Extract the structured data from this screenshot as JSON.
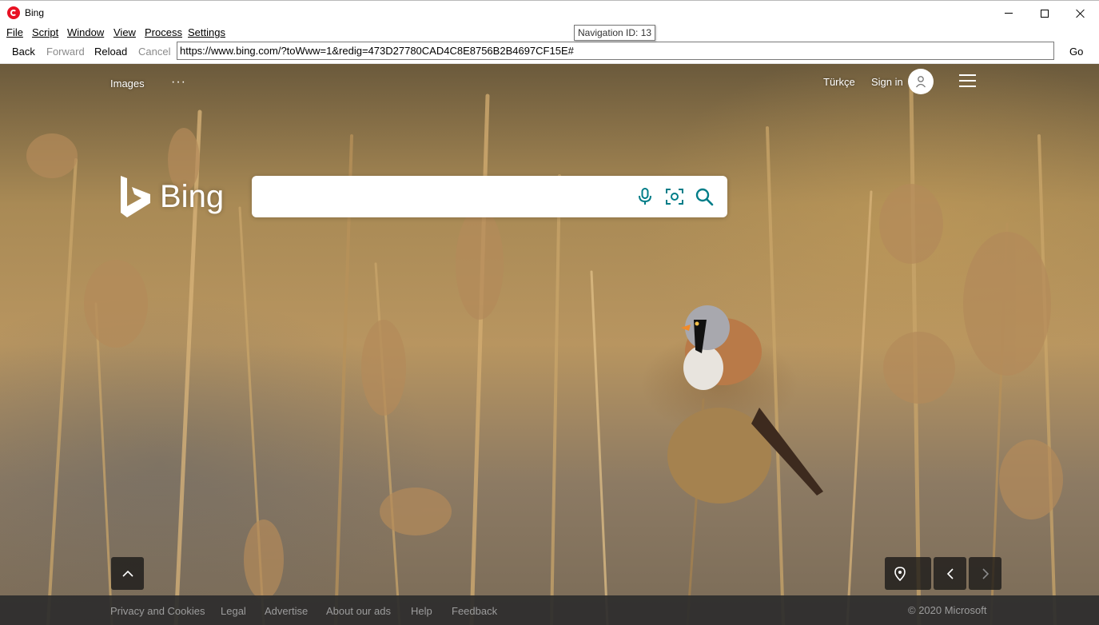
{
  "window": {
    "title": "Bing"
  },
  "menu": [
    "File",
    "Script",
    "Window",
    "View",
    "Process",
    "Settings"
  ],
  "tooltip": "Navigation ID: 13",
  "toolbar": {
    "back": "Back",
    "forward": "Forward",
    "reload": "Reload",
    "cancel": "Cancel",
    "url": "https://www.bing.com/?toWww=1&redig=473D27780CAD4C8E8756B2B4697CF15E#",
    "go": "Go"
  },
  "bing": {
    "top_left_link": "Images",
    "more": "···",
    "language": "Türkçe",
    "sign_in": "Sign in",
    "logo_text": "Bing",
    "search_placeholder": "",
    "colors": {
      "accent": "#007d88",
      "brand": "#ffffff"
    }
  },
  "footer": {
    "links": [
      "Privacy and Cookies",
      "Legal",
      "Advertise",
      "About our ads",
      "Help",
      "Feedback"
    ],
    "copyright": "© 2020 Microsoft"
  }
}
